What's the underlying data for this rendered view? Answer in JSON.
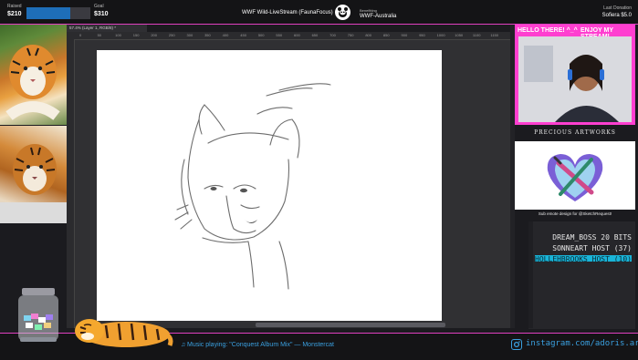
{
  "top_bar": {
    "raised_label": "Raised",
    "raised_value": "$210",
    "goal_label": "Goal",
    "goal_value": "$310",
    "progress_fraction": 0.68,
    "stream_title": "WWF Wild-LiveStream (FaunaFocus)",
    "beneficiary_label": "Benefitting",
    "beneficiary_value": "WWF-Australia",
    "last_donation_label": "Last Donation",
    "last_donation_value": "Sofiera $5.0"
  },
  "editor": {
    "document_tab": "57.4% (Layer 1, RGB/8) *",
    "ruler_ticks": [
      "0",
      "50",
      "100",
      "150",
      "200",
      "250",
      "300",
      "350",
      "400",
      "450",
      "500",
      "550",
      "600",
      "650",
      "700",
      "750",
      "800",
      "850",
      "900",
      "950",
      "1000",
      "1050",
      "1100",
      "1150"
    ]
  },
  "webcam": {
    "banner_left": "HELLO THERE! ^_^",
    "banner_right": "ENJOY MY STREAM!"
  },
  "artworks": {
    "title": "PRECIOUS ARTWORKS",
    "caption": "Sub emote design for @SketchRequest!"
  },
  "events": [
    {
      "text": "DREAM_BOSS  20 BITS"
    },
    {
      "text": "SONNEART  HOST (37)"
    },
    {
      "text": "HOLLEHBROOKS  HOST (10)"
    }
  ],
  "footer": {
    "music_note": "♫",
    "music_text": "Music playing: \"Conquest Album Mix\"  — Monstercat",
    "instagram_handle": "instagram.com/adoris.arts"
  },
  "colors": {
    "accent_magenta": "#ff3fd0",
    "progress_blue": "#1e6eb8",
    "footer_blue": "#3aa0e0",
    "highlight_cyan": "#19b4d8"
  },
  "icons": [
    "wwf-panda-icon",
    "instagram-icon",
    "music-note-icon"
  ]
}
